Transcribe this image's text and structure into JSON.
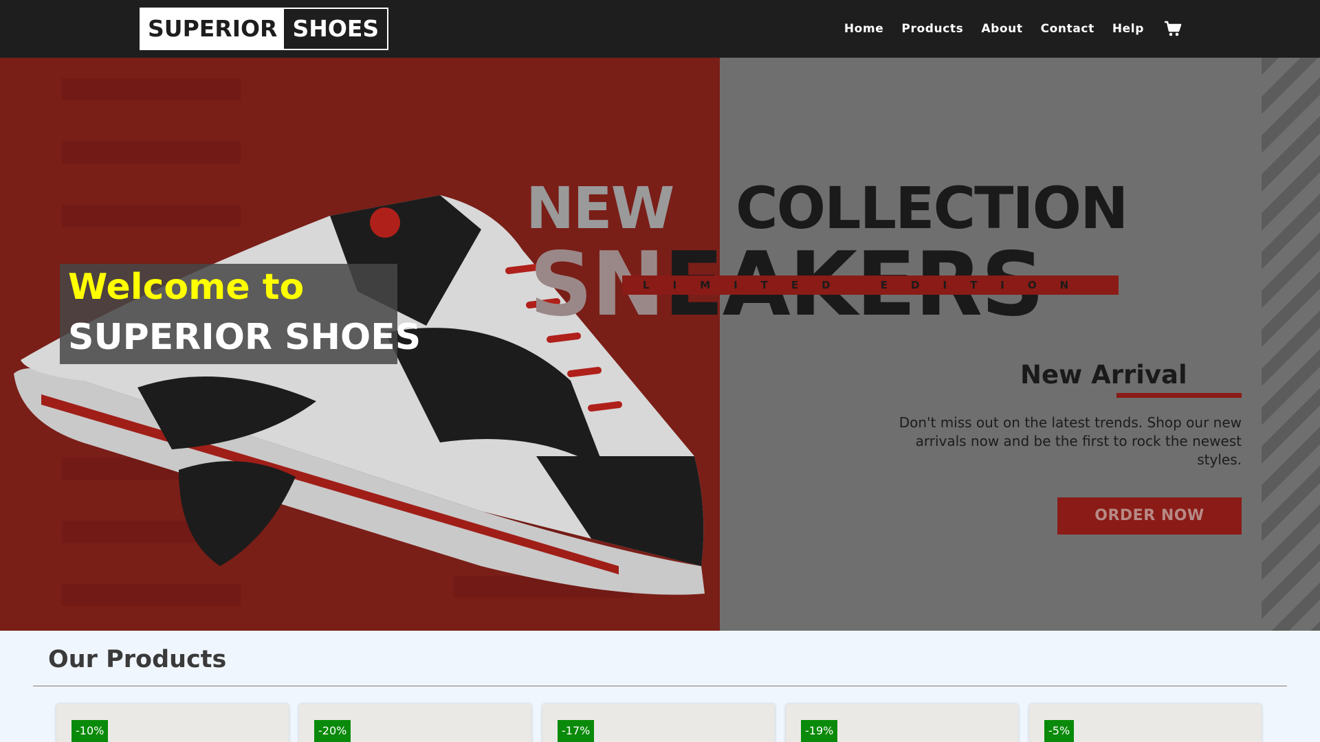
{
  "navbar": {
    "logo_left": "SUPERIOR",
    "logo_right": "SHOES",
    "links": [
      "Home",
      "Products",
      "About",
      "Contact",
      "Help"
    ],
    "cart_icon": "cart-icon"
  },
  "hero": {
    "word_new": "NEW",
    "word_collection": "COLLECTION",
    "word_sneakers_faded": "SN",
    "word_sneakers_rest": "EAKERS",
    "limited": "LIMITED EDITION",
    "new_arrival": "New Arrival",
    "promo_text": "Don't miss out on the latest trends. Shop our new arrivals now and be the first to rock the newest styles.",
    "order_button": "ORDER NOW",
    "welcome_line1": "Welcome to",
    "welcome_line2": "SUPERIOR SHOES",
    "colors": {
      "left_bg": "#7a1e18",
      "right_bg": "#6f6f6f",
      "accent": "#8a1b16",
      "welcome_yellow": "#ffff00"
    }
  },
  "products": {
    "title": "Our Products",
    "discounts": [
      "-10%",
      "-20%",
      "-17%",
      "-19%",
      "-5%"
    ],
    "badge_color": "#0a8a0a"
  }
}
